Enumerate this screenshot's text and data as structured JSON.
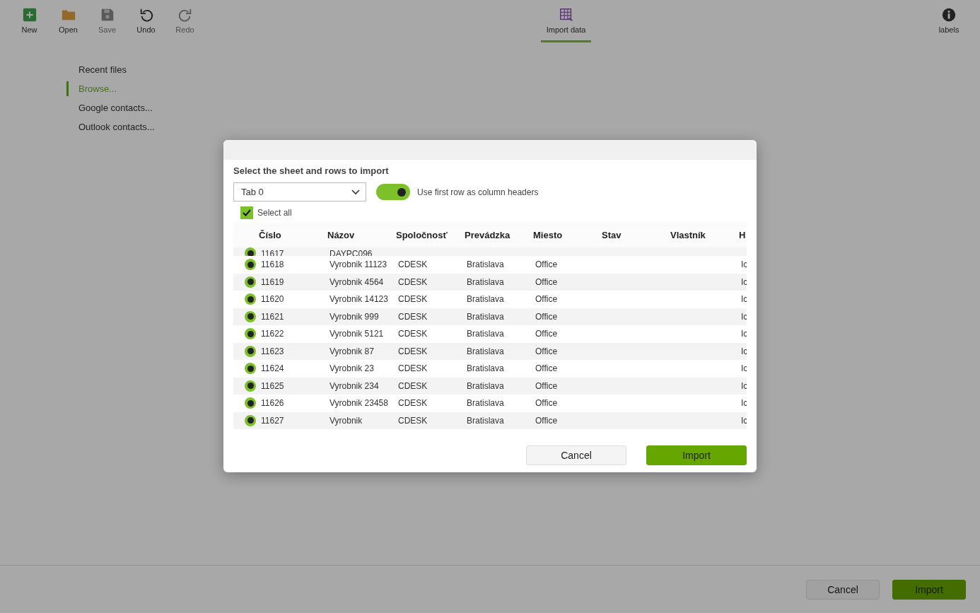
{
  "toolbar": {
    "items": [
      {
        "label": "New",
        "disabled": false
      },
      {
        "label": "Open",
        "disabled": false
      },
      {
        "label": "Save",
        "disabled": true
      },
      {
        "label": "Undo",
        "disabled": false
      },
      {
        "label": "Redo",
        "disabled": true
      }
    ],
    "tabs": [
      {
        "label": "Import data",
        "selected": true
      }
    ],
    "right": {
      "label": "labels"
    }
  },
  "sidebar": {
    "items": [
      {
        "label": "Recent files",
        "selected": false
      },
      {
        "label": "Browse...",
        "selected": true
      },
      {
        "label": "Google contacts...",
        "selected": false
      },
      {
        "label": "Outlook contacts...",
        "selected": false
      }
    ]
  },
  "footer": {
    "buttons": [
      {
        "label": "Cancel",
        "kind": "secondary"
      },
      {
        "label": "Import",
        "kind": "primary"
      }
    ]
  },
  "dialog": {
    "heading": "Select the sheet and rows to import",
    "sheet_select": {
      "value": "Tab 0"
    },
    "header_toggle": {
      "label": "Use first row as column headers",
      "on": true
    },
    "select_all": {
      "label": "Select all",
      "checked": true
    },
    "table": {
      "columns": [
        "Číslo",
        "Názov",
        "Spoločnosť",
        "Prevádzka",
        "Miesto",
        "Stav",
        "Vlastník",
        "H"
      ],
      "rows": [
        {
          "selected": true,
          "cells": [
            "11617",
            "DAYPC096",
            "",
            "",
            "",
            "",
            "",
            ""
          ]
        },
        {
          "selected": true,
          "cells": [
            "11618",
            "Vyrobnik 11123",
            "CDESK",
            "Bratislava",
            "Office",
            "",
            "",
            "Ic"
          ]
        },
        {
          "selected": true,
          "cells": [
            "11619",
            "Vyrobnik 4564",
            "CDESK",
            "Bratislava",
            "Office",
            "",
            "",
            "Ic"
          ]
        },
        {
          "selected": true,
          "cells": [
            "11620",
            "Vyrobnik 14123",
            "CDESK",
            "Bratislava",
            "Office",
            "",
            "",
            "Ic"
          ]
        },
        {
          "selected": true,
          "cells": [
            "11621",
            "Vyrobnik 999",
            "CDESK",
            "Bratislava",
            "Office",
            "",
            "",
            "Ic"
          ]
        },
        {
          "selected": true,
          "cells": [
            "11622",
            "Vyrobnik 5121",
            "CDESK",
            "Bratislava",
            "Office",
            "",
            "",
            "Ic"
          ]
        },
        {
          "selected": true,
          "cells": [
            "11623",
            "Vyrobnik 87",
            "CDESK",
            "Bratislava",
            "Office",
            "",
            "",
            "Ic"
          ]
        },
        {
          "selected": true,
          "cells": [
            "11624",
            "Vyrobnik 23",
            "CDESK",
            "Bratislava",
            "Office",
            "",
            "",
            "Ic"
          ]
        },
        {
          "selected": true,
          "cells": [
            "11625",
            "Vyrobnik 234",
            "CDESK",
            "Bratislava",
            "Office",
            "",
            "",
            "Ic"
          ]
        },
        {
          "selected": true,
          "cells": [
            "11626",
            "Vyrobnik 23458",
            "CDESK",
            "Bratislava",
            "Office",
            "",
            "",
            "Ic"
          ]
        },
        {
          "selected": true,
          "cells": [
            "11627",
            "Vyrobnik",
            "CDESK",
            "Bratislava",
            "Office",
            "",
            "",
            "Ic"
          ]
        }
      ]
    },
    "buttons": [
      {
        "label": "Cancel",
        "kind": "secondary"
      },
      {
        "label": "Import",
        "kind": "primary"
      }
    ]
  }
}
